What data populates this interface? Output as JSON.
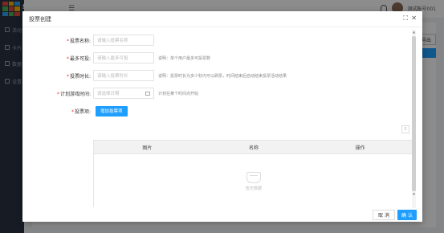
{
  "app": {
    "brand": "智慧现场",
    "nav_items": [
      "活动",
      "卡片",
      "数据",
      "设置"
    ],
    "user_name": "测试账号001",
    "export_label": "导出"
  },
  "modal": {
    "title": "投票创建",
    "fields": {
      "name": {
        "label": "投票名称:",
        "placeholder": "请输入投票名称"
      },
      "max_votes": {
        "label": "最多可投:",
        "placeholder": "请输入最多可投",
        "hint": "说明：单个用户最多可投票数"
      },
      "duration": {
        "label": "投票时长:",
        "placeholder": "请输入投票时长",
        "hint": "说明：投票时长为多少秒内可以刷票，时间结束后自动结束投票活动结果"
      },
      "start_time": {
        "label": "计划游戏时间:",
        "placeholder": "请选择日期",
        "hint": "计划在某个时间点开始"
      },
      "items": {
        "label": "投票项:",
        "add_button": "增加投票项"
      }
    },
    "table": {
      "columns": [
        "图片",
        "名称",
        "操作"
      ],
      "empty_text": "暂无数据"
    },
    "footer": {
      "cancel": "取 消",
      "ok": "确 认"
    }
  },
  "colors": {
    "primary": "#1e9fff",
    "sidebar": "#2b3442",
    "required": "#e33333"
  }
}
